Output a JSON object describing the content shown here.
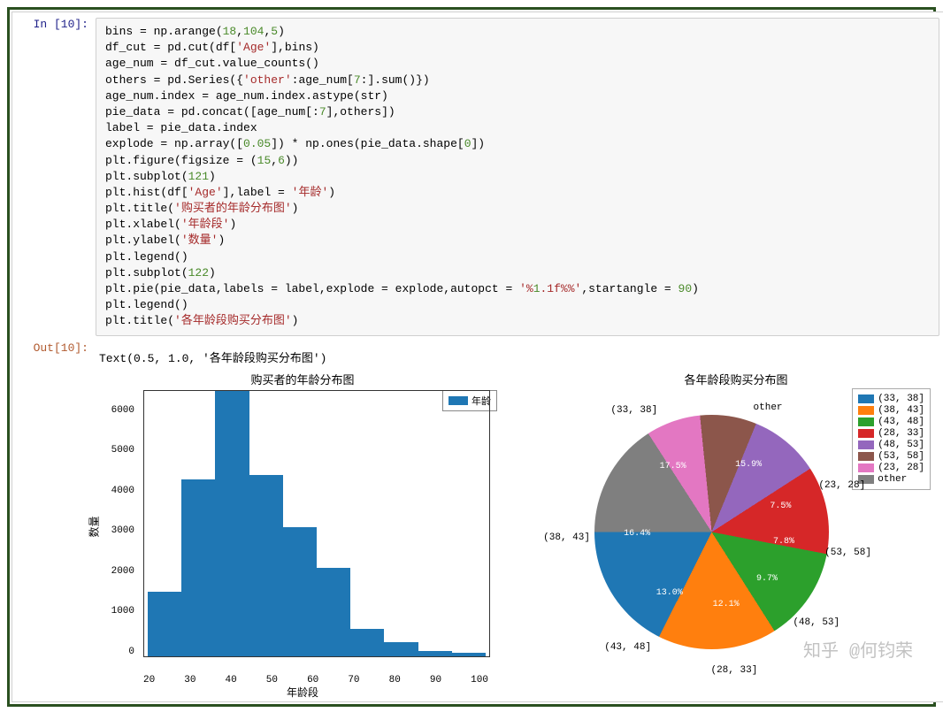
{
  "in_prompt": "In  [10]:",
  "out_prompt": "Out[10]:",
  "code_lines": [
    "bins = np.arange(18,104,5)",
    "df_cut = pd.cut(df['Age'],bins)",
    "age_num = df_cut.value_counts()",
    "others = pd.Series({'other':age_num[7:].sum()})",
    "age_num.index = age_num.index.astype(str)",
    "pie_data = pd.concat([age_num[:7],others])",
    "label = pie_data.index",
    "explode = np.array([0.05]) * np.ones(pie_data.shape[0])",
    "plt.figure(figsize = (15,6))",
    "plt.subplot(121)",
    "plt.hist(df['Age'],label = '年龄')",
    "plt.title('购买者的年龄分布图')",
    "plt.xlabel('年龄段')",
    "plt.ylabel('数量')",
    "plt.legend()",
    "plt.subplot(122)",
    "plt.pie(pie_data,labels = label,explode = explode,autopct = '%1.1f%%',startangle = 90)",
    "plt.legend()",
    "plt.title('各年龄段购买分布图')"
  ],
  "out_text": "Text(0.5, 1.0, '各年龄段购买分布图')",
  "hist_legend_label": "年龄",
  "xlabel": "年龄段",
  "ylabel": "数量",
  "watermark": "知乎  @何钧荣",
  "chart_data": [
    {
      "type": "bar",
      "title": "购买者的年龄分布图",
      "xlabel": "年龄段",
      "ylabel": "数量",
      "x_ticks": [
        20,
        30,
        40,
        50,
        60,
        70,
        80,
        90,
        100
      ],
      "y_ticks": [
        0,
        1000,
        2000,
        3000,
        4000,
        5000,
        6000
      ],
      "ylim": [
        0,
        6600
      ],
      "series": [
        {
          "name": "年龄",
          "values": [
            1600,
            4400,
            6600,
            4500,
            3200,
            2200,
            680,
            340,
            120,
            80
          ]
        }
      ]
    },
    {
      "type": "pie",
      "title": "各年龄段购买分布图",
      "startangle": 90,
      "slices": [
        {
          "label": "(33, 38]",
          "pct": 17.5,
          "color": "#1f77b4"
        },
        {
          "label": "(38, 43]",
          "pct": 16.4,
          "color": "#ff7f0e"
        },
        {
          "label": "(43, 48]",
          "pct": 13.0,
          "color": "#2ca02c"
        },
        {
          "label": "(28, 33]",
          "pct": 12.1,
          "color": "#d62728"
        },
        {
          "label": "(48, 53]",
          "pct": 9.7,
          "color": "#9467bd"
        },
        {
          "label": "(53, 58]",
          "pct": 7.8,
          "color": "#8c564b"
        },
        {
          "label": "(23, 28]",
          "pct": 7.5,
          "color": "#e377c2"
        },
        {
          "label": "other",
          "pct": 15.9,
          "color": "#7f7f7f"
        }
      ],
      "legend_items": [
        "(33, 38]",
        "(38, 43]",
        "(43, 48]",
        "(28, 33]",
        "(48, 53]",
        "(53, 58]",
        "(23, 28]",
        "other"
      ]
    }
  ]
}
